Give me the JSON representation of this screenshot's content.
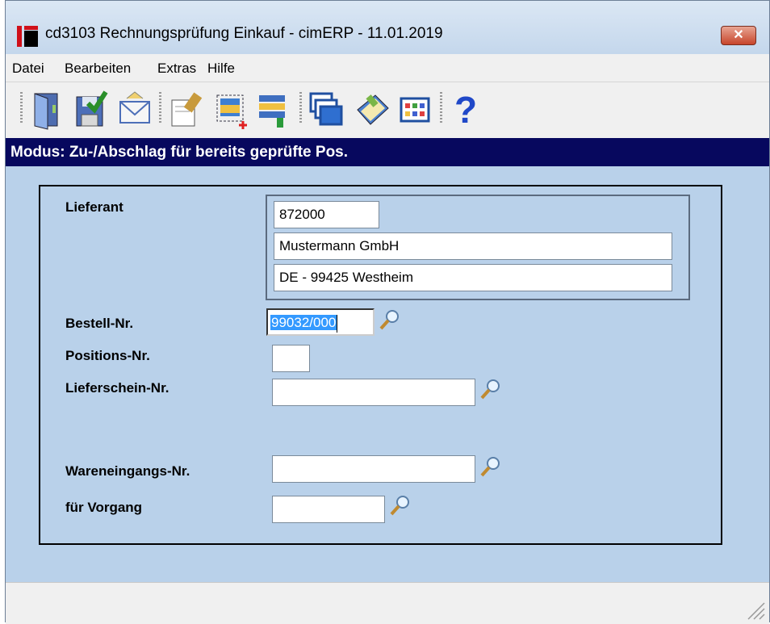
{
  "window": {
    "title": "cd3103 Rechnungsprüfung Einkauf - cimERP - 11.01.2019",
    "close_label": "✕"
  },
  "menu": {
    "items": [
      "Datei",
      "Bearbeiten",
      "Extras",
      "Hilfe"
    ]
  },
  "toolbar": {
    "buttons": [
      "exit-door-icon",
      "save-check-icon",
      "envelope-icon",
      "edit-document-icon",
      "new-record-icon",
      "list-transfer-icon",
      "windows-icon",
      "book-icon",
      "table-grid-icon",
      "help-icon"
    ],
    "help_label": "?"
  },
  "mode": {
    "text": "Modus: Zu-/Abschlag für bereits geprüfte Pos."
  },
  "form": {
    "lieferant_label": "Lieferant",
    "lieferant_nr": "872000",
    "lieferant_name": "Mustermann GmbH",
    "lieferant_ort": "DE - 99425 Westheim",
    "bestell_label": "Bestell-Nr.",
    "bestell_value": "99032/000",
    "positions_label": "Positions-Nr.",
    "positions_value": "",
    "lieferschein_label": "Lieferschein-Nr.",
    "lieferschein_value": "",
    "wareneingang_label": "Wareneingangs-Nr.",
    "wareneingang_value": "",
    "vorgang_label": "für Vorgang",
    "vorgang_value": ""
  },
  "colors": {
    "mode_bar": "#07085e",
    "client_bg": "#b9d1ea",
    "selection": "#3399ff",
    "close_button": "#c7452b"
  }
}
